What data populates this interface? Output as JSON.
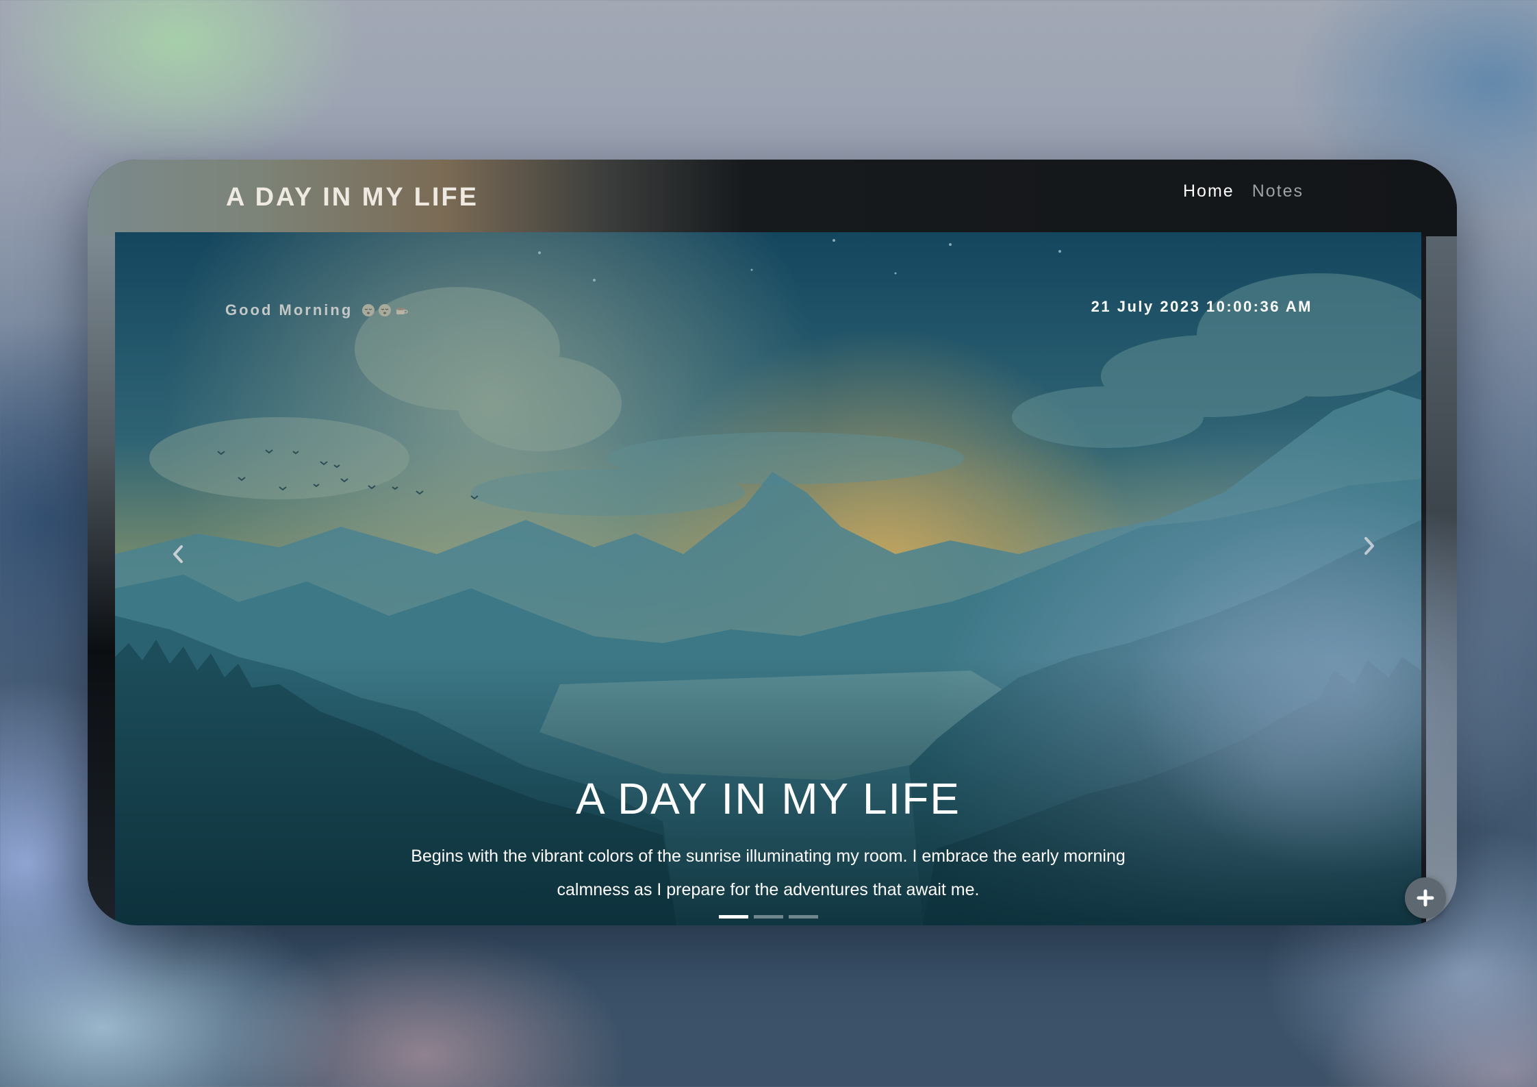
{
  "header": {
    "brand": "A DAY IN MY LIFE",
    "nav": [
      {
        "label": "Home",
        "active": true
      },
      {
        "label": "Notes",
        "active": false
      }
    ]
  },
  "hero": {
    "greeting": "Good Morning",
    "greeting_emojis": [
      "sleepy-face-icon",
      "sleepy-face-icon",
      "coffee-cup-icon"
    ],
    "datetime": "21 July 2023 10:00:36 AM",
    "title": "A DAY IN MY LIFE",
    "text": "Begins with the vibrant colors of the sunrise illuminating my room. I embrace the early morning calmness as I prepare for the adventures that await me.",
    "slides_total": 3,
    "active_slide": 1
  },
  "colors": {
    "accent": "#ffffff",
    "header_bg": "#131619",
    "sky_top": "#14465e",
    "sun_glow": "#b8a25a"
  },
  "icons": {
    "prev": "chevron-left-icon",
    "next": "chevron-right-icon",
    "add": "plus-icon"
  }
}
